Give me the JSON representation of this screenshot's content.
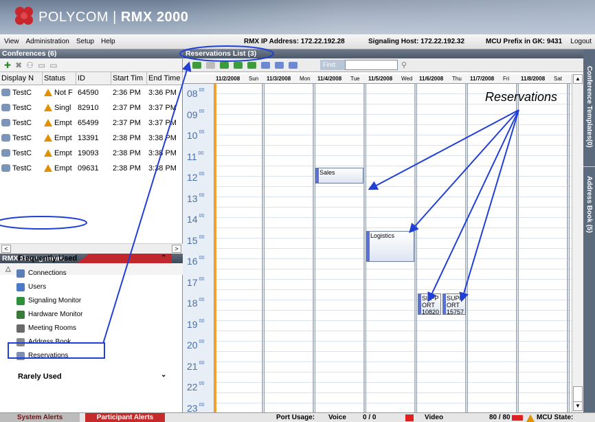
{
  "app": {
    "brand": "POLYCOM",
    "product": "RMX 2000"
  },
  "menubar": {
    "items": [
      "View",
      "Administration",
      "Setup",
      "Help"
    ],
    "ip": "RMX IP Address: 172.22.192.28",
    "signaling": "Signaling Host: 172.22.192.32",
    "prefix": "MCU Prefix in GK: 9431",
    "logout": "Logout"
  },
  "conferences": {
    "title": "Conferences (6)",
    "columns": [
      "Display N",
      "Status",
      "ID",
      "Start Tim",
      "End Time"
    ],
    "rows": [
      {
        "name": "TestC",
        "status": "Not F",
        "id": "64590",
        "start": "2:36 PM",
        "end": "3:36 PM"
      },
      {
        "name": "TestC",
        "status": "Singl",
        "id": "82910",
        "start": "2:37 PM",
        "end": "3:37 PM"
      },
      {
        "name": "TestC",
        "status": "Empt",
        "id": "65499",
        "start": "2:37 PM",
        "end": "3:37 PM"
      },
      {
        "name": "TestC",
        "status": "Empt",
        "id": "13391",
        "start": "2:38 PM",
        "end": "3:38 PM"
      },
      {
        "name": "TestC",
        "status": "Empt",
        "id": "19093",
        "start": "2:38 PM",
        "end": "3:38 PM"
      },
      {
        "name": "TestC",
        "status": "Empt",
        "id": "09631",
        "start": "2:38 PM",
        "end": "3:38 PM"
      }
    ]
  },
  "management": {
    "title": "RMX Management",
    "frequent_label": "Frequently Used",
    "rare_label": "Rarely Used",
    "items": [
      "Connections",
      "Users",
      "Signaling Monitor",
      "Hardware Monitor",
      "Meeting Rooms",
      "Address Book",
      "Reservations"
    ]
  },
  "reservations": {
    "title": "Reservations List (3)",
    "find_label": "Find:",
    "days": [
      {
        "date": "11/2/2008",
        "dow": "Sun"
      },
      {
        "date": "11/3/2008",
        "dow": "Mon"
      },
      {
        "date": "11/4/2008",
        "dow": "Tue"
      },
      {
        "date": "11/5/2008",
        "dow": "Wed"
      },
      {
        "date": "11/6/2008",
        "dow": "Thu"
      },
      {
        "date": "11/7/2008",
        "dow": "Fri"
      },
      {
        "date": "11/8/2008",
        "dow": "Sat"
      }
    ],
    "hours": [
      "08",
      "09",
      "10",
      "11",
      "12",
      "13",
      "14",
      "15",
      "16",
      "17",
      "18",
      "19",
      "20",
      "21",
      "22",
      "23"
    ],
    "minutes": "00",
    "events": [
      {
        "label": "Sales",
        "day": 2,
        "start": 12.0,
        "end": 12.75
      },
      {
        "label": "Logistics",
        "day": 3,
        "start": 15.0,
        "end": 16.5
      },
      {
        "label": "SUPPORT10820",
        "display": [
          "SUPP",
          "ORT",
          "10820"
        ],
        "day": 4,
        "start": 18.0,
        "end": 19.0
      },
      {
        "label": "SUPPORT15757",
        "display": [
          "SUPP",
          "ORT",
          "15757"
        ],
        "day": 4,
        "start": 18.0,
        "end": 19.0
      }
    ]
  },
  "side_tabs": {
    "templates": "Conference Templates(0)",
    "address_book": "Address Book (5)"
  },
  "status_bar": {
    "system_alerts": "System Alerts",
    "participant_alerts": "Participant Alerts",
    "port_usage": "Port Usage:",
    "voice_label": "Voice",
    "voice_value": "0 / 0",
    "video_label": "Video",
    "video_value": "80 / 80",
    "mcu_state": "MCU State: MAJOR"
  },
  "annotation": {
    "callout": "Reservations"
  },
  "colors": {
    "accent_red": "#c62b2b",
    "event_bar": "#5b6fd6",
    "annotation_blue": "#1f3fd6"
  }
}
